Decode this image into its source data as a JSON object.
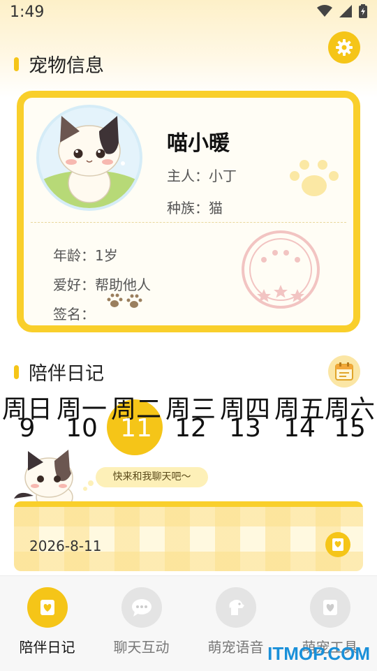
{
  "status_bar": {
    "time": "1:49"
  },
  "pet_info": {
    "section_title": "宠物信息",
    "name": "喵小暖",
    "owner": "主人：小丁",
    "species": "种族：猫",
    "age": "年龄：1岁",
    "hobby": "爱好：帮助他人",
    "signature": "签名："
  },
  "diary": {
    "section_title": "陪伴日记",
    "week": [
      {
        "weekday": "周日",
        "day": "9"
      },
      {
        "weekday": "周一",
        "day": "10"
      },
      {
        "weekday": "周二",
        "day": "11"
      },
      {
        "weekday": "周三",
        "day": "12"
      },
      {
        "weekday": "周四",
        "day": "13"
      },
      {
        "weekday": "周五",
        "day": "14"
      },
      {
        "weekday": "周六",
        "day": "15"
      }
    ],
    "selected_day": "11",
    "bubble_text": "快来和我聊天吧～",
    "entry_date": "2026-8-11"
  },
  "tabs": [
    {
      "label": "陪伴日记",
      "icon": "diary-icon",
      "active": true
    },
    {
      "label": "聊天互动",
      "icon": "chat-icon",
      "active": false
    },
    {
      "label": "萌宠语音",
      "icon": "dog-voice-icon",
      "active": false
    },
    {
      "label": "萌宠工具",
      "icon": "tool-icon",
      "active": false
    }
  ],
  "watermark": "ITMOP.COM",
  "colors": {
    "accent": "#f5c518",
    "card_border": "#f9cf2b",
    "watermark": "#1a90d9"
  }
}
